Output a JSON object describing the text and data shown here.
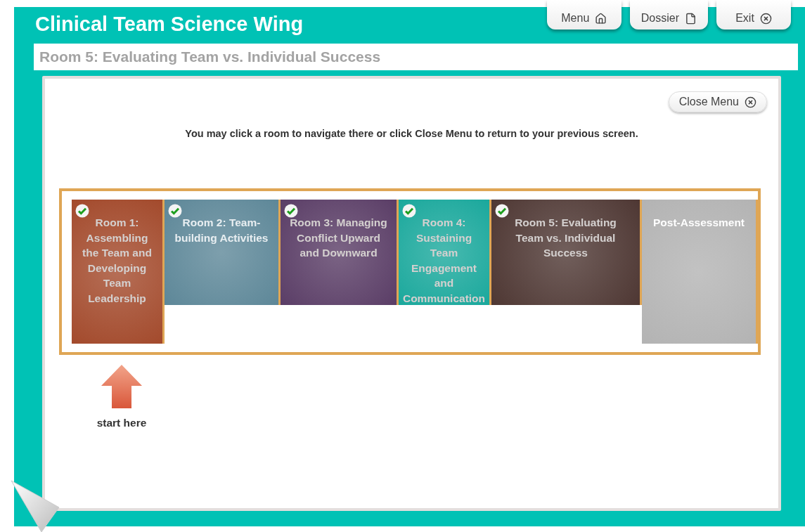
{
  "window": {
    "title": "Clinical Team Science Wing"
  },
  "nav_buttons": [
    {
      "label": "Menu",
      "kind": "home"
    },
    {
      "label": "Dossier",
      "kind": "file"
    },
    {
      "label": "Exit",
      "kind": "close"
    }
  ],
  "subtitle": "Room 5: Evaluating Team vs. Individual Success",
  "close_menu": {
    "label": "Close Menu"
  },
  "instruction": "You may click a room to navigate there or click Close Menu to return to your previous screen.",
  "rooms": [
    {
      "label": "Room 1: Assembling the Team and Developing Team Leadership",
      "color": "#a34a2c",
      "completed": true,
      "dimmed": false,
      "kind": "tall"
    },
    {
      "label": "Room 2: Team-building Activities",
      "color": "#5d8798",
      "completed": true,
      "dimmed": true,
      "kind": "short"
    },
    {
      "label": "Room 3: Managing Conflict Upward and Downward",
      "color": "#5a3d66",
      "completed": true,
      "dimmed": false,
      "kind": "short"
    },
    {
      "label": "Room 4: Sustaining Team Engagement and Communication",
      "color": "#1aa89c",
      "completed": true,
      "dimmed": false,
      "kind": "short"
    },
    {
      "label": "Room 5: Evaluating Team vs. Individual Success",
      "color": "#4e3733",
      "completed": true,
      "dimmed": false,
      "kind": "short"
    },
    {
      "label": "Post-Assessment",
      "color": "#b3b3b3",
      "completed": false,
      "dimmed": false,
      "kind": "tall"
    }
  ],
  "start": {
    "label": "start here"
  }
}
